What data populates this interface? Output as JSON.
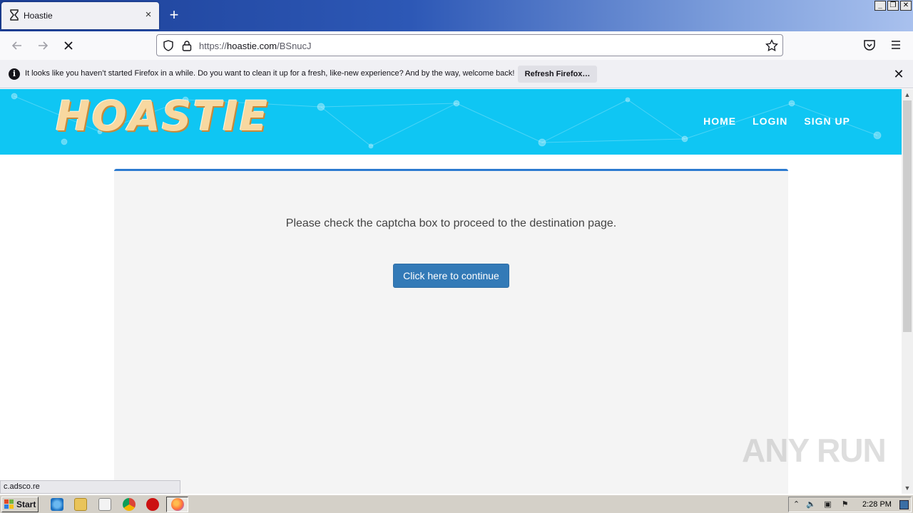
{
  "window": {
    "tab_title": "Hoastie",
    "tab_close": "×",
    "new_tab": "+",
    "controls": [
      "_",
      "❐",
      "✕"
    ]
  },
  "navbar": {
    "url_prefix": "https://",
    "url_host": "hoastie.com",
    "url_path": "/BSnucJ"
  },
  "notification": {
    "message": "It looks like you haven’t started Firefox in a while. Do you want to clean it up for a fresh, like-new experience? And by the way, welcome back!",
    "button_label": "Refresh Firefox…",
    "close": "✕"
  },
  "site": {
    "logo": "HOASTIE",
    "nav": [
      "HOME",
      "LOGIN",
      "SIGN UP"
    ],
    "message": "Please check the captcha box to proceed to the destination page.",
    "continue_label": "Click here to continue",
    "header_color": "#0fc6f3",
    "accent_color": "#337ab7"
  },
  "status_url": "c.adsco.re",
  "watermark": "ANY RUN",
  "taskbar": {
    "start_label": "Start",
    "clock": "2:28 PM"
  }
}
